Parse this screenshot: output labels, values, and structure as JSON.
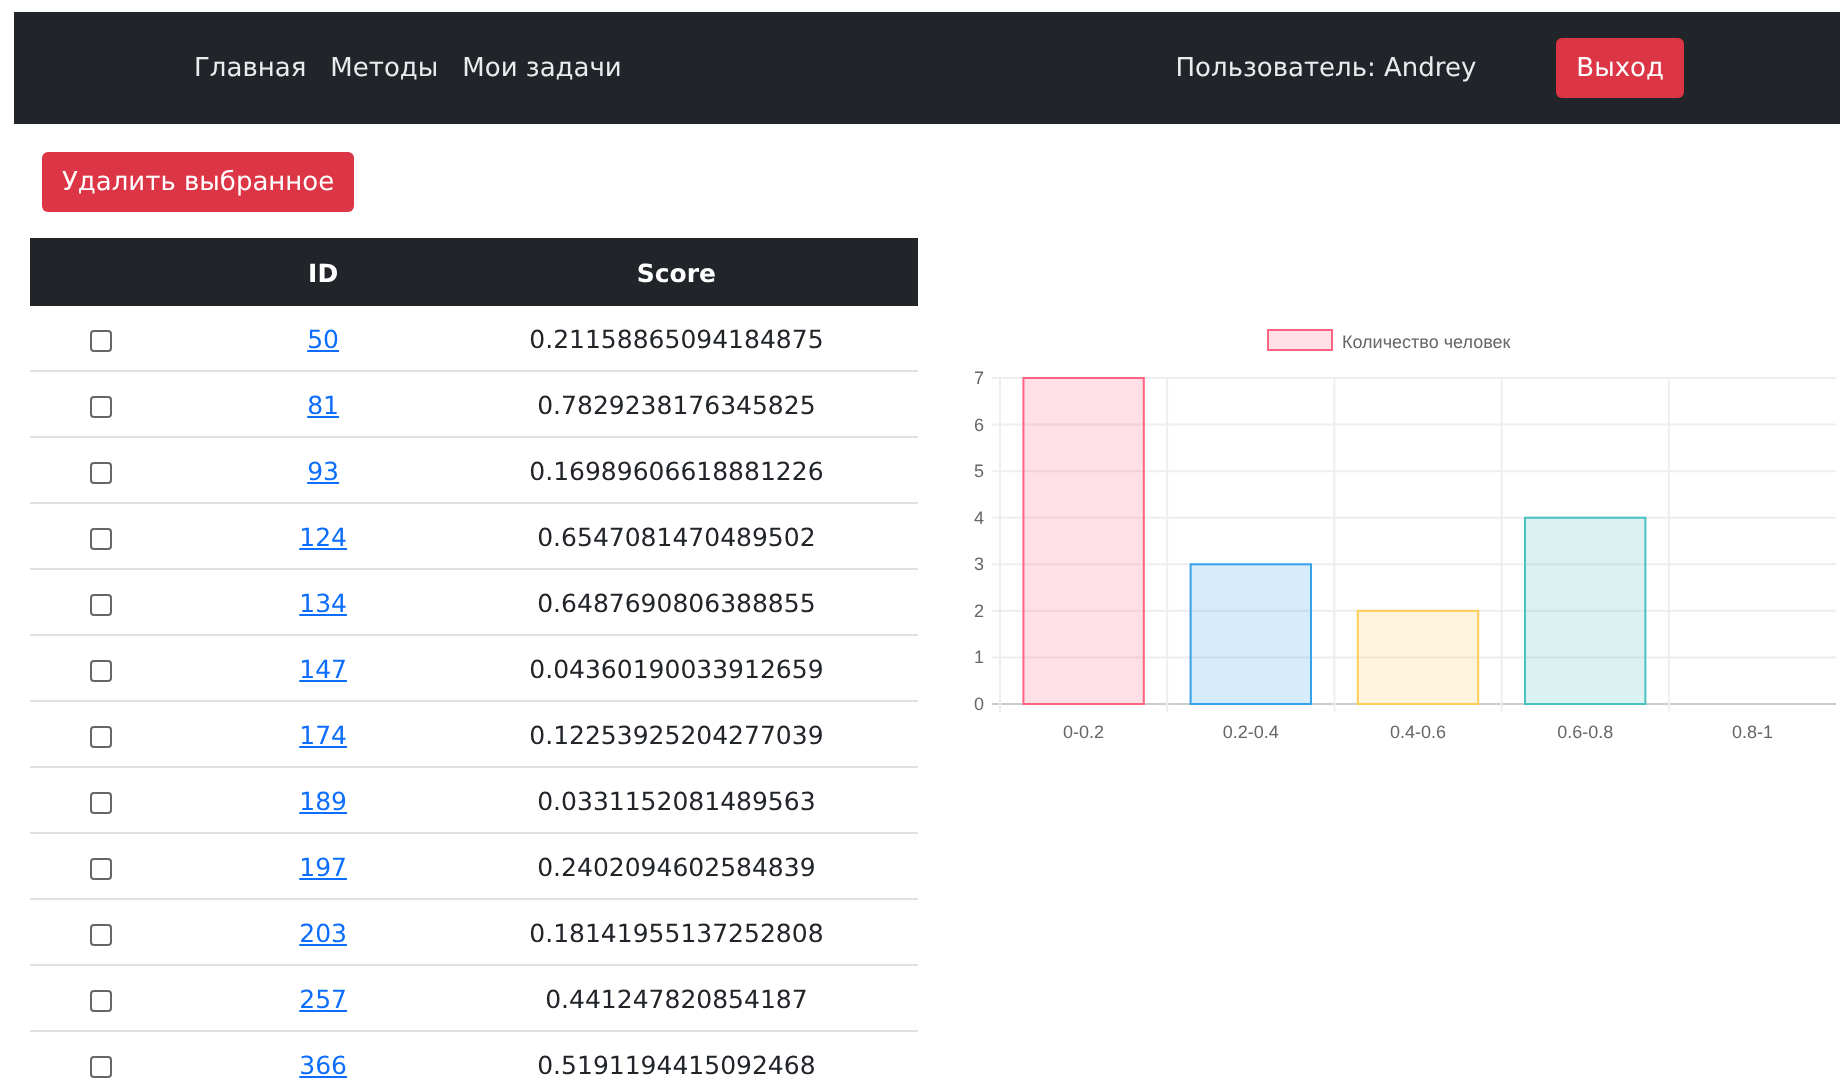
{
  "navbar": {
    "links": [
      "Главная",
      "Методы",
      "Мои задачи"
    ],
    "user": "Пользователь: Andrey",
    "logout": "Выход"
  },
  "delete_button": "Удалить выбранное",
  "table": {
    "columns": [
      "",
      "ID",
      "Score"
    ],
    "rows": [
      {
        "checked": false,
        "id": "50",
        "score": "0.21158865094184875"
      },
      {
        "checked": false,
        "id": "81",
        "score": "0.7829238176345825"
      },
      {
        "checked": false,
        "id": "93",
        "score": "0.16989606618881226"
      },
      {
        "checked": false,
        "id": "124",
        "score": "0.6547081470489502"
      },
      {
        "checked": false,
        "id": "134",
        "score": "0.6487690806388855"
      },
      {
        "checked": false,
        "id": "147",
        "score": "0.04360190033912659"
      },
      {
        "checked": false,
        "id": "174",
        "score": "0.12253925204277039"
      },
      {
        "checked": false,
        "id": "189",
        "score": "0.0331152081489563"
      },
      {
        "checked": false,
        "id": "197",
        "score": "0.2402094602584839"
      },
      {
        "checked": false,
        "id": "203",
        "score": "0.18141955137252808"
      },
      {
        "checked": false,
        "id": "257",
        "score": "0.441247820854187"
      },
      {
        "checked": false,
        "id": "366",
        "score": "0.5191194415092468"
      }
    ]
  },
  "chart": {
    "chart_data": {
      "type": "bar",
      "categories": [
        "0-0.2",
        "0.2-0.4",
        "0.4-0.6",
        "0.6-0.8",
        "0.8-1"
      ],
      "series": [
        {
          "name": "Количество человек",
          "color": "#ff6384",
          "colors": [
            "#ff6384",
            "#36a2eb",
            "#ffce56",
            "#4bc0c0",
            "#9966ff"
          ],
          "values": [
            7,
            3,
            2,
            4,
            0
          ]
        }
      ],
      "grid": true,
      "ylim": [
        0,
        7
      ],
      "yticks": [
        0,
        1,
        2,
        3,
        4,
        5,
        6,
        7
      ]
    }
  }
}
